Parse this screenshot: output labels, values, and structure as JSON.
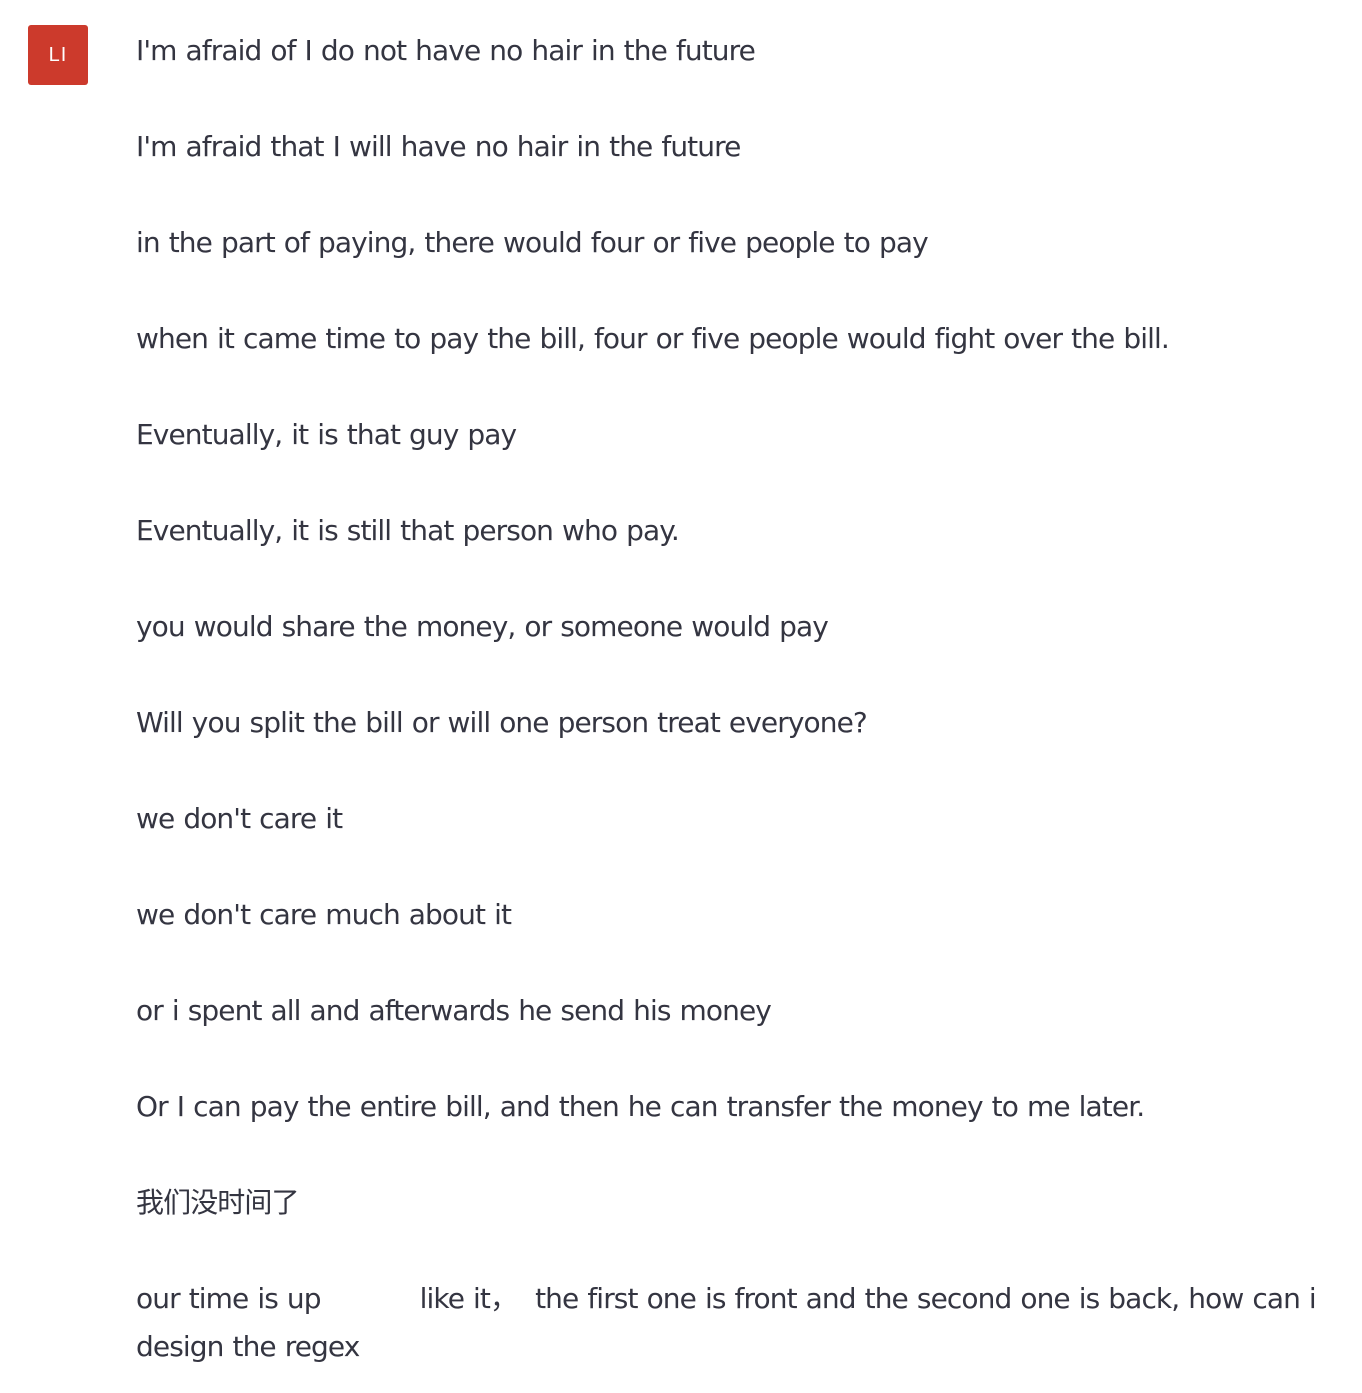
{
  "user": {
    "avatar_initials": "LI",
    "avatar_color": "#cc3a2c"
  },
  "message": {
    "lines": [
      "I'm afraid of I do not have no hair in the future",
      "I'm afraid that I will have no hair in the future",
      "in the part of paying, there would four or five people to pay",
      "when it came time to pay the bill, four or five people would fight over the bill.",
      "Eventually, it is that guy pay",
      "Eventually, it is still that person who pay.",
      "you would share the money, or someone would pay",
      "Will you split the bill or will one person treat everyone?",
      "we don't care it",
      "we don't care much about it",
      "or i spent all and afterwards he send his money",
      "Or I can pay the entire bill, and then he can transfer the money to me later.",
      "我们没时间了",
      "our time is up           like it，  the first one is front and the second one is back, how can i design the regex"
    ]
  }
}
